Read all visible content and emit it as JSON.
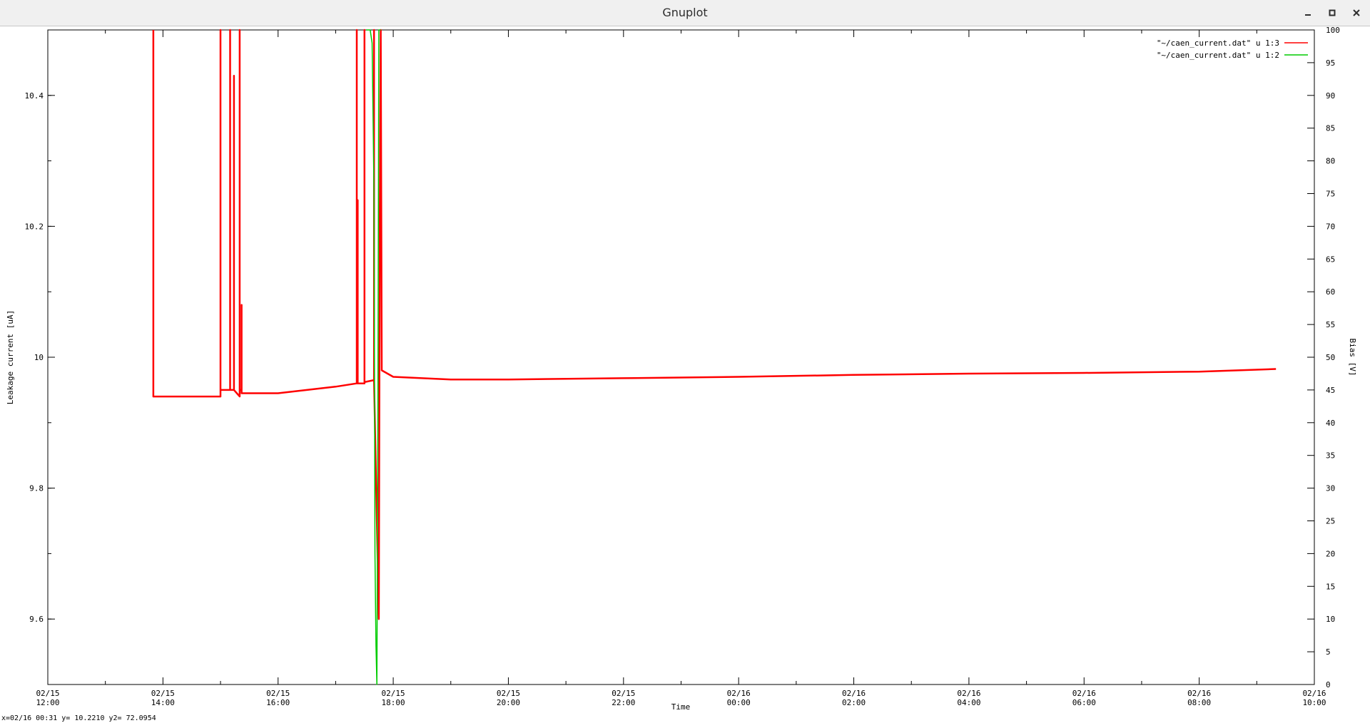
{
  "window": {
    "title": "Gnuplot",
    "controls": {
      "minimize": "minimize-icon",
      "maximize": "maximize-icon",
      "close": "close-icon"
    }
  },
  "status_bar": {
    "readout": "x=02/16 00:31 y= 10.2210 y2= 72.0954"
  },
  "colors": {
    "series_current": "#ff0000",
    "series_bias": "#00cc00",
    "axes": "#000000"
  },
  "chart_data": {
    "type": "line",
    "xlabel": "Time",
    "ylabel": "Leakage current [uA]",
    "y2label": "Bias [V]",
    "xlim": [
      "02/15 12:00",
      "02/16 10:00"
    ],
    "ylim": [
      9.5,
      10.5
    ],
    "y2lim": [
      0,
      100
    ],
    "x_ticks": [
      {
        "date": "02/15",
        "time": "12:00"
      },
      {
        "date": "02/15",
        "time": "14:00"
      },
      {
        "date": "02/15",
        "time": "16:00"
      },
      {
        "date": "02/15",
        "time": "18:00"
      },
      {
        "date": "02/15",
        "time": "20:00"
      },
      {
        "date": "02/15",
        "time": "22:00"
      },
      {
        "date": "02/16",
        "time": "00:00"
      },
      {
        "date": "02/16",
        "time": "02:00"
      },
      {
        "date": "02/16",
        "time": "04:00"
      },
      {
        "date": "02/16",
        "time": "06:00"
      },
      {
        "date": "02/16",
        "time": "08:00"
      },
      {
        "date": "02/16",
        "time": "10:00"
      }
    ],
    "y_ticks": [
      "9.6",
      "9.8",
      "10",
      "10.2",
      "10.4"
    ],
    "y2_ticks": [
      "0",
      "5",
      "10",
      "15",
      "20",
      "25",
      "30",
      "35",
      "40",
      "45",
      "50",
      "55",
      "60",
      "65",
      "70",
      "75",
      "80",
      "85",
      "90",
      "95",
      "100"
    ],
    "grid": false,
    "legend_position": "top-right",
    "series": [
      {
        "name": "\"~/caen_current.dat\" u 1:3",
        "axis": "y",
        "color": "#ff0000",
        "points": [
          [
            "02/15 13:50",
            10.5
          ],
          [
            "02/15 13:50",
            9.94
          ],
          [
            "02/15 14:30",
            9.94
          ],
          [
            "02/15 15:00",
            9.94
          ],
          [
            "02/15 15:00",
            10.5
          ],
          [
            "02/15 15:00",
            9.95
          ],
          [
            "02/15 15:10",
            9.95
          ],
          [
            "02/15 15:10",
            10.5
          ],
          [
            "02/15 15:10",
            9.95
          ],
          [
            "02/15 15:14",
            9.95
          ],
          [
            "02/15 15:14",
            10.43
          ],
          [
            "02/15 15:14",
            9.95
          ],
          [
            "02/15 15:20",
            9.94
          ],
          [
            "02/15 15:20",
            10.5
          ],
          [
            "02/15 15:20",
            9.95
          ],
          [
            "02/15 15:22",
            9.95
          ],
          [
            "02/15 15:22",
            10.08
          ],
          [
            "02/15 15:22",
            9.945
          ],
          [
            "02/15 16:00",
            9.945
          ],
          [
            "02/15 16:30",
            9.95
          ],
          [
            "02/15 17:00",
            9.955
          ],
          [
            "02/15 17:22",
            9.96
          ],
          [
            "02/15 17:22",
            10.5
          ],
          [
            "02/15 17:22",
            9.96
          ],
          [
            "02/15 17:23",
            9.96
          ],
          [
            "02/15 17:23",
            10.24
          ],
          [
            "02/15 17:23",
            9.96
          ],
          [
            "02/15 17:30",
            9.96
          ],
          [
            "02/15 17:30",
            10.5
          ],
          [
            "02/15 17:30",
            9.962
          ],
          [
            "02/15 17:40",
            9.965
          ],
          [
            "02/15 17:40",
            10.5
          ],
          [
            "02/15 17:40",
            9.965
          ],
          [
            "02/15 17:45",
            9.6
          ],
          [
            "02/15 17:46",
            10.23
          ],
          [
            "02/15 17:47",
            10.5
          ],
          [
            "02/15 17:48",
            9.98
          ],
          [
            "02/15 18:00",
            9.97
          ],
          [
            "02/15 19:00",
            9.966
          ],
          [
            "02/15 20:00",
            9.966
          ],
          [
            "02/15 22:00",
            9.968
          ],
          [
            "02/16 00:00",
            9.97
          ],
          [
            "02/16 02:00",
            9.973
          ],
          [
            "02/16 04:00",
            9.975
          ],
          [
            "02/16 06:00",
            9.976
          ],
          [
            "02/16 08:00",
            9.978
          ],
          [
            "02/16 09:20",
            9.982
          ]
        ]
      },
      {
        "name": "\"~/caen_current.dat\" u 1:2",
        "axis": "y2",
        "color": "#00cc00",
        "points": [
          [
            "02/15 17:32",
            100
          ],
          [
            "02/15 17:36",
            100
          ],
          [
            "02/15 17:38",
            98
          ],
          [
            "02/15 17:40",
            75
          ],
          [
            "02/15 17:41",
            20
          ],
          [
            "02/15 17:42",
            6
          ],
          [
            "02/15 17:43",
            0
          ],
          [
            "02/15 17:44",
            40
          ],
          [
            "02/15 17:45",
            100
          ],
          [
            "02/15 17:47",
            100
          ]
        ]
      }
    ]
  }
}
